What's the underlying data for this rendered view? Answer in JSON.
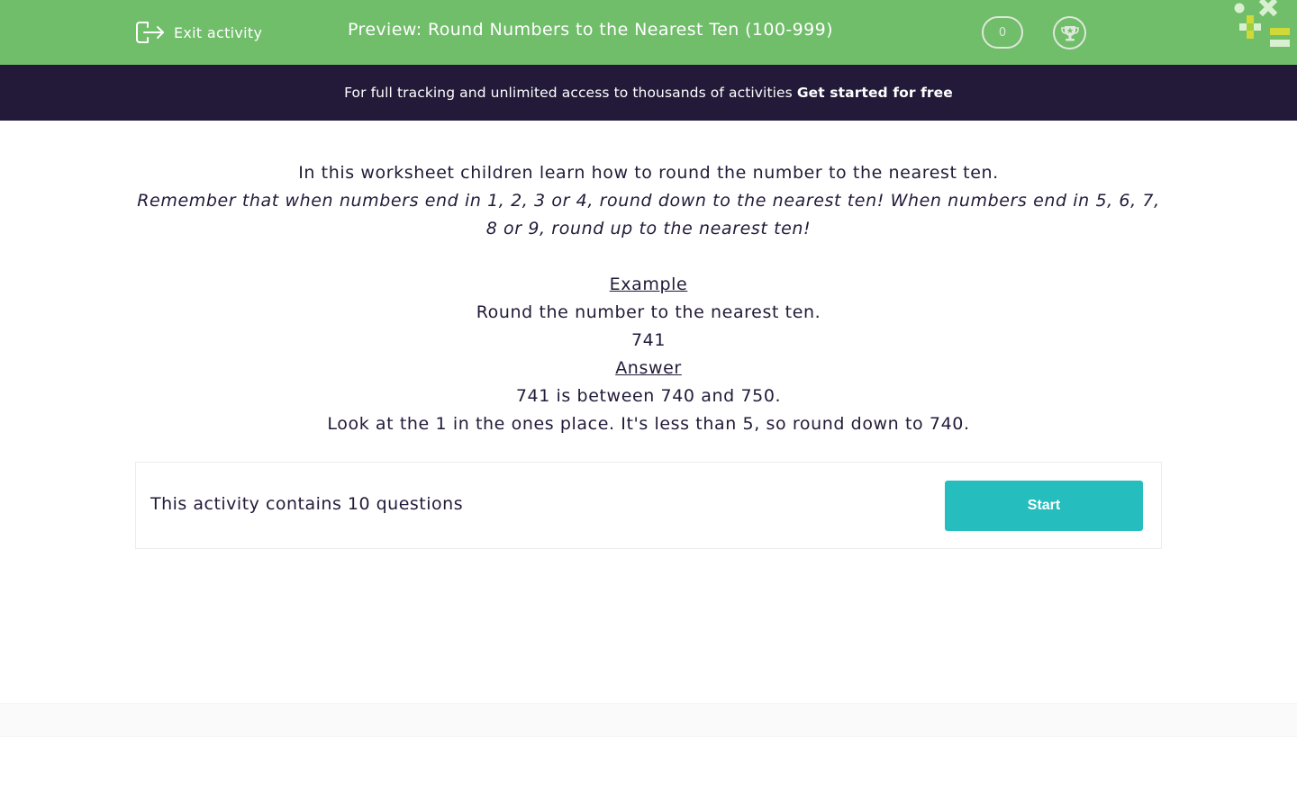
{
  "header": {
    "exit_label": "Exit activity",
    "title": "Preview: Round Numbers to the Nearest Ten (100-999)",
    "score": "0",
    "icons": [
      "exit-icon",
      "trophy-icon",
      "logo-math-symbols"
    ],
    "brand_color": "#70bd6a"
  },
  "promo": {
    "text": "For full tracking and unlimited access to thousands of activities",
    "cta": "Get started for free",
    "background": "#221a38"
  },
  "intro": {
    "line1": "In this worksheet children learn how to round the number to the nearest ten.",
    "reminder": "Remember that when numbers end in 1, 2, 3 or 4, round down to the nearest ten! When numbers end in 5, 6, 7, 8 or 9, round up to the nearest ten!",
    "example_heading": "Example",
    "example_prompt": "Round the number to the nearest ten.",
    "example_number": "741",
    "answer_heading": "Answer",
    "answer_line1": "741 is between 740 and 750.",
    "answer_line2": "Look at the 1 in the ones place. It's less than 5, so round down to 740."
  },
  "activity": {
    "count_text": "This activity contains 10 questions",
    "start_label": "Start",
    "start_color": "#25bdbe"
  }
}
